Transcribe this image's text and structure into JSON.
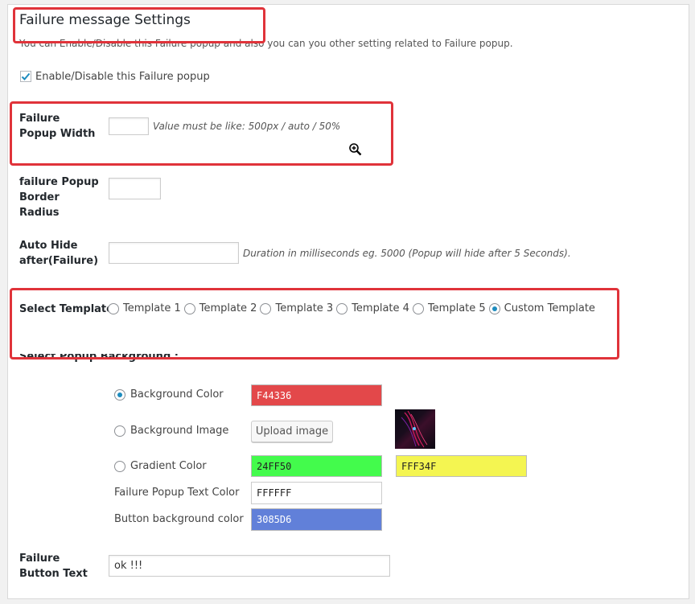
{
  "header": {
    "title": "Failure message Settings",
    "description": "You can Enable/Disable this Failure popup and also you can you other setting related to Failure popup."
  },
  "enable": {
    "label": "Enable/Disable this Failure popup",
    "checked": true
  },
  "width": {
    "label": "Failure Popup Width",
    "value": "",
    "hint": "Value must be like: 500px / auto / 50%"
  },
  "radius": {
    "label": "failure Popup Border Radius",
    "value": ""
  },
  "auto_hide": {
    "label": "Auto Hide after(Failure)",
    "value": "",
    "hint": "Duration in milliseconds eg. 5000 (Popup will hide after 5 Seconds)."
  },
  "template": {
    "label": "Select Template",
    "options": [
      "Template 1",
      "Template 2",
      "Template 3",
      "Template 4",
      "Template 5",
      "Custom Template"
    ],
    "selected": "Custom Template"
  },
  "background": {
    "label": "Select Popup Background :",
    "color_label": "Background Color",
    "color_value": "F44336",
    "image_label": "Background Image",
    "upload_label": "Upload image",
    "gradient_label": "Gradient Color",
    "gradient_start": "24FF50",
    "gradient_end": "FFF34F",
    "selected": "Background Color"
  },
  "text_color": {
    "label": "Failure Popup Text Color",
    "value": "FFFFFF"
  },
  "button_bg": {
    "label": "Button background color",
    "value": "3085D6"
  },
  "button_text": {
    "label": "Failure Button Text",
    "value": "ok !!!"
  },
  "colors": {
    "bg_color": "#e3484a",
    "gradient_start": "#43fb4c",
    "gradient_end": "#f4f551",
    "text_color": "#ffffff",
    "button_bg": "#6180d9",
    "highlight": "#e0333a"
  }
}
